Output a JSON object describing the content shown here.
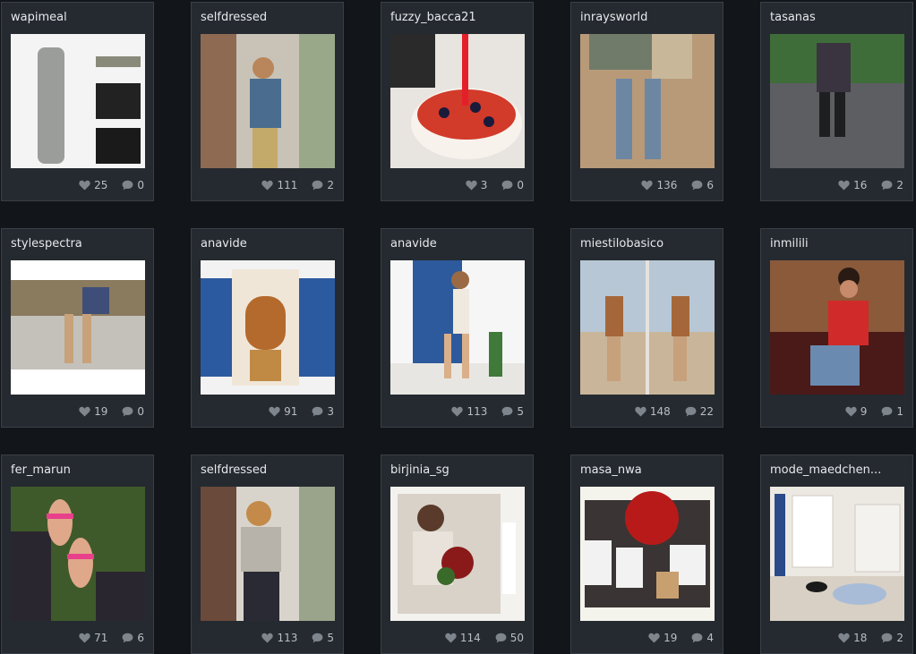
{
  "colors": {
    "page_bg": "#121519",
    "card_bg": "#252a30",
    "text": "#e6e9ec",
    "meta": "#b9bec4"
  },
  "posts": [
    {
      "user": "wapimeal",
      "likes": "25",
      "comments": "0"
    },
    {
      "user": "selfdressed",
      "likes": "111",
      "comments": "2"
    },
    {
      "user": "fuzzy_bacca21",
      "likes": "3",
      "comments": "0"
    },
    {
      "user": "inraysworld",
      "likes": "136",
      "comments": "6"
    },
    {
      "user": "tasanas",
      "likes": "16",
      "comments": "2"
    },
    {
      "user": "stylespectra",
      "likes": "19",
      "comments": "0"
    },
    {
      "user": "anavide",
      "likes": "91",
      "comments": "3"
    },
    {
      "user": "anavide",
      "likes": "113",
      "comments": "5"
    },
    {
      "user": "miestilobasico",
      "likes": "148",
      "comments": "22"
    },
    {
      "user": "inmilili",
      "likes": "9",
      "comments": "1"
    },
    {
      "user": "fer_marun",
      "likes": "71",
      "comments": "6"
    },
    {
      "user": "selfdressed",
      "likes": "113",
      "comments": "5"
    },
    {
      "user": "birjinia_sg",
      "likes": "114",
      "comments": "50"
    },
    {
      "user": "masa_nwa",
      "likes": "19",
      "comments": "4"
    },
    {
      "user": "mode_maedchen...",
      "likes": "18",
      "comments": "2"
    }
  ]
}
